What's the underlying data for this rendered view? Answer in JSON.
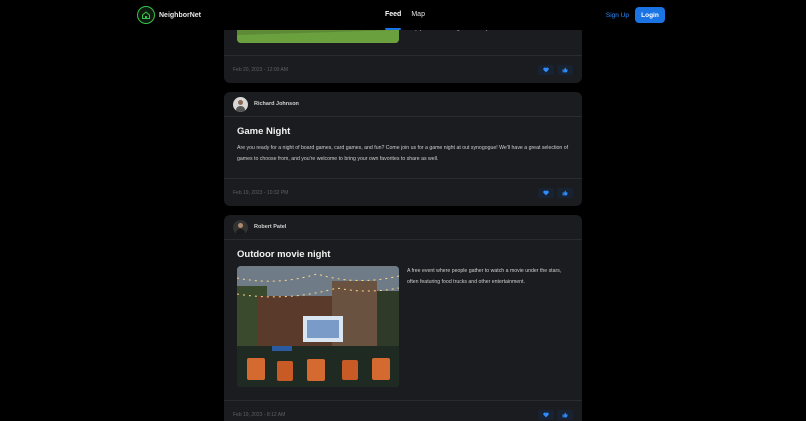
{
  "nav": {
    "brand": "NeighborNet",
    "links": [
      {
        "label": "Feed",
        "active": true
      },
      {
        "label": "Map",
        "active": false
      }
    ],
    "signup": "Sign Up",
    "login": "Login"
  },
  "posts": [
    {
      "text_tail": "keep you fueled throughout the day.",
      "timestamp": "Feb 20, 2023 - 12:00 AM"
    },
    {
      "author": "Richard Johnson",
      "title": "Game Night",
      "text": "Are you ready for a night of board games, card games, and fun? Come join us for a game night at out synogogue! We'll have a great selection of games to choose from, and you're welcome to bring your own favorites to share as well.",
      "timestamp": "Feb 19, 2023 - 10:32 PM"
    },
    {
      "author": "Robert Patel",
      "title": "Outdoor movie night",
      "text": "A free event where people gather to watch a movie under the stars, often featuring food trucks and other entertainment.",
      "timestamp": "Feb 19, 2023 - 8:12 AM"
    }
  ],
  "colors": {
    "accent": "#1b74e4",
    "logo": "#35c24a",
    "card": "#1b1c1f"
  }
}
